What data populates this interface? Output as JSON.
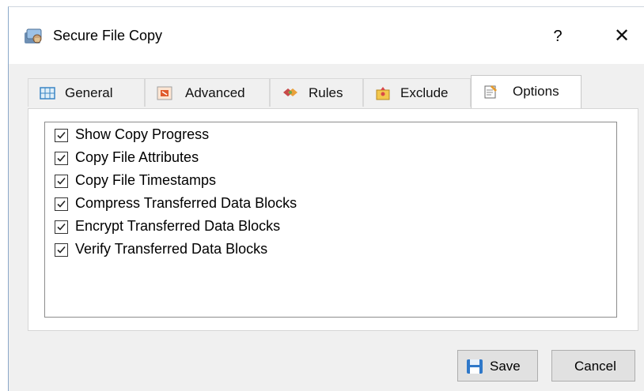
{
  "window": {
    "title": "Secure File Copy",
    "help_label": "?",
    "close_label": "✕"
  },
  "tabs": [
    {
      "label": "General",
      "icon": "grid-icon",
      "active": false
    },
    {
      "label": "Advanced",
      "icon": "advanced-icon",
      "active": false
    },
    {
      "label": "Rules",
      "icon": "rules-icon",
      "active": false
    },
    {
      "label": "Exclude",
      "icon": "exclude-icon",
      "active": false
    },
    {
      "label": "Options",
      "icon": "options-icon",
      "active": true
    }
  ],
  "options": [
    {
      "label": "Show Copy Progress",
      "checked": true
    },
    {
      "label": "Copy File Attributes",
      "checked": true
    },
    {
      "label": "Copy File Timestamps",
      "checked": true
    },
    {
      "label": "Compress Transferred Data Blocks",
      "checked": true
    },
    {
      "label": "Encrypt Transferred Data Blocks",
      "checked": true
    },
    {
      "label": "Verify Transferred Data Blocks",
      "checked": true
    }
  ],
  "buttons": {
    "save": "Save",
    "cancel": "Cancel"
  },
  "colors": {
    "accent": "#0078d7",
    "window_bg": "#f0f0f0",
    "border": "#8aa8c9"
  }
}
